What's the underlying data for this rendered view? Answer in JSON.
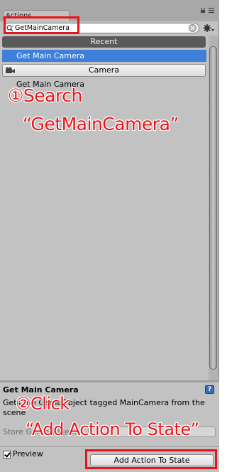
{
  "window": {
    "tab_label": "Actions"
  },
  "search": {
    "value": "GetMainCamera",
    "icon": "search-icon"
  },
  "list": {
    "recent_header": "Recent",
    "selected_item": "Get Main Camera",
    "category_label": "Camera",
    "category_icon": "camera-icon",
    "items": [
      "Get Main Camera"
    ]
  },
  "annotations": {
    "step1_line1": "①Search",
    "step1_line2": "“GetMainCamera”",
    "step2_line1": "②Click",
    "step2_line2": "“Add Action To State”",
    "color": "#e8141b"
  },
  "description": {
    "title": "Get Main Camera",
    "text": "Gets the GameObject tagged MainCamera from the scene",
    "store_label": "Store Game Object",
    "help_icon": "help-icon"
  },
  "footer": {
    "preview_label": "Preview",
    "preview_checked": true,
    "add_button_label": "Add Action To State"
  },
  "colors": {
    "selection": "#3d7fd9",
    "panel": "#c2c2c2",
    "annotation": "#e8141b"
  }
}
